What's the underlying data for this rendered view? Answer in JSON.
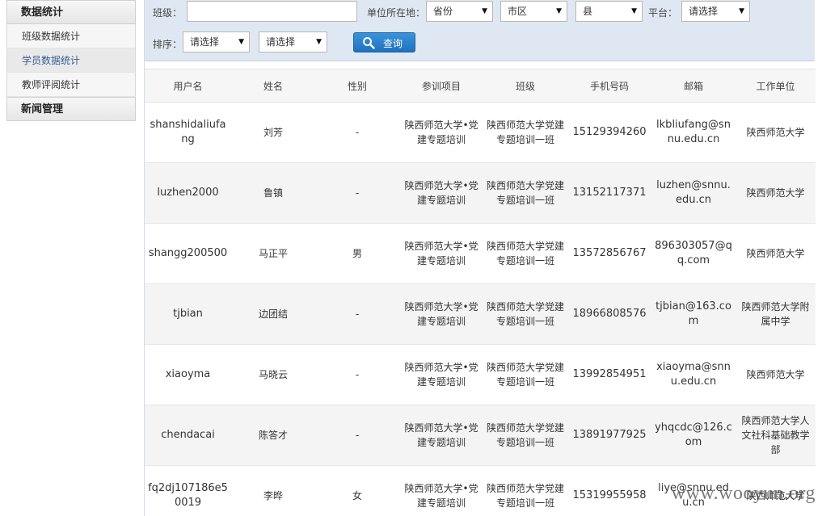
{
  "sidebar": {
    "section1": "数据统计",
    "items": [
      {
        "label": "班级数据统计"
      },
      {
        "label": "学员数据统计"
      },
      {
        "label": "教师评阅统计"
      }
    ],
    "section2": "新闻管理"
  },
  "filter": {
    "class_label": "班级：",
    "class_value": "",
    "location_label": "单位所在地：",
    "province": "省份",
    "city": "市区",
    "county": "县",
    "platform_label": "平台：",
    "platform": "请选择",
    "sort_label": "排序：",
    "sort1": "请选择",
    "sort2": "请选择",
    "search_label": "查询"
  },
  "table": {
    "headers": [
      "用户名",
      "姓名",
      "性别",
      "参训项目",
      "班级",
      "手机号码",
      "邮箱",
      "工作单位"
    ],
    "rows": [
      [
        "shanshidaliufang",
        "刘芳",
        "-",
        "陕西师范大学•党建专题培训",
        "陕西师范大学党建专题培训一班",
        "15129394260",
        "lkbliufang@snnu.edu.cn",
        "陕西师范大学"
      ],
      [
        "luzhen2000",
        "鲁镇",
        "-",
        "陕西师范大学•党建专题培训",
        "陕西师范大学党建专题培训一班",
        "13152117371",
        "luzhen@snnu.edu.cn",
        "陕西师范大学"
      ],
      [
        "shangg200500",
        "马正平",
        "男",
        "陕西师范大学•党建专题培训",
        "陕西师范大学党建专题培训一班",
        "13572856767",
        "896303057@qq.com",
        "陕西师范大学"
      ],
      [
        "tjbian",
        "边团结",
        "-",
        "陕西师范大学•党建专题培训",
        "陕西师范大学党建专题培训一班",
        "18966808576",
        "tjbian@163.com",
        "陕西师范大学附属中学"
      ],
      [
        "xiaoyma",
        "马晓云",
        "-",
        "陕西师范大学•党建专题培训",
        "陕西师范大学党建专题培训一班",
        "13992854951",
        "xiaoyma@snnu.edu.cn",
        "陕西师范大学"
      ],
      [
        "chendacai",
        "陈答才",
        "-",
        "陕西师范大学•党建专题培训",
        "陕西师范大学党建专题培训一班",
        "13891977925",
        "yhqcdc@126.com",
        "陕西师范大学人文社科基础教学部"
      ],
      [
        "fq2dj107186e50019",
        "李晔",
        "女",
        "陕西师范大学•党建专题培训",
        "陕西师范大学党建专题培训一班",
        "15319955958",
        "liye@snnu.edu.cn",
        "陕西师范大学"
      ]
    ]
  },
  "watermark": "www.wooyun.org"
}
